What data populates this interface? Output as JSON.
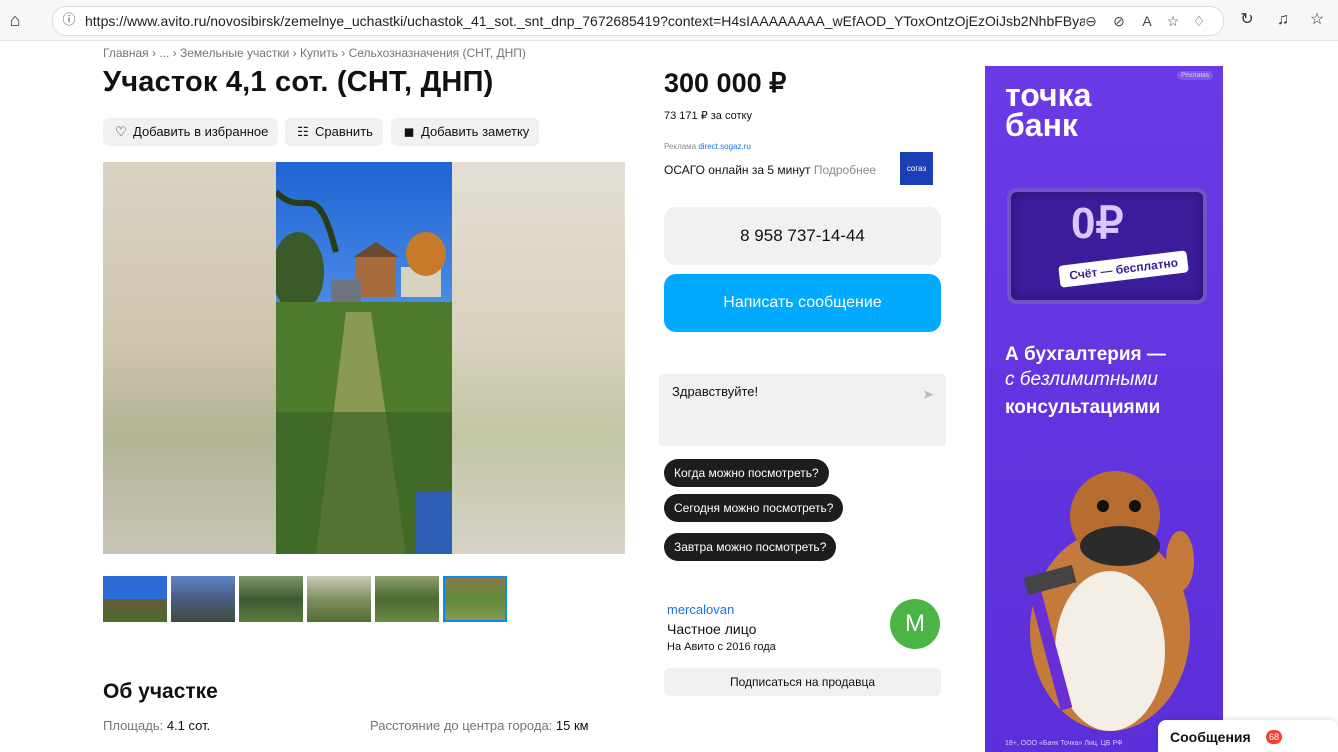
{
  "browser": {
    "url": "https://www.avito.ru/novosibirsk/zemelnye_uchastki/uchastok_41_sot._snt_dnp_7672685419?context=H4sIAAAAAAAA_wEfAOD_YToxOntzOjEzOiJsb2NhbFByaW9yaXR..."
  },
  "breadcrumbs": "Главная › ... › Земельные участки › Купить › Сельхозназначения (СНТ, ДНП)",
  "listing": {
    "title": "Участок 4,1 сот. (СНТ, ДНП)",
    "actions": {
      "favorite": "Добавить в избранное",
      "compare": "Сравнить",
      "note": "Добавить заметку"
    },
    "about_heading": "Об участке",
    "params": [
      {
        "label": "Площадь:",
        "value": "4.1 сот."
      },
      {
        "label": "Расстояние до центра города:",
        "value": "15 км"
      }
    ],
    "thumbnails_count": 6,
    "selected_thumbnail": 6
  },
  "sidebar": {
    "price": "300 000 ₽",
    "price_per": "73 171 ₽ за сотку",
    "ad_label": "Реклама",
    "ad_domain": "direct.sogaz.ru",
    "ad_text": "ОСАГО онлайн за 5 минут",
    "ad_more": "Подробнее",
    "ad_logo_text": "согаз",
    "phone": "8 958 737-14-44",
    "write_button": "Написать сообщение",
    "chat_text": "Здравствуйте!",
    "quick_questions": [
      "Когда можно посмотреть?",
      "Сегодня можно посмотреть?",
      "Завтра можно посмотреть?"
    ],
    "seller_name": "mercalovan",
    "seller_type": "Частное лицо",
    "seller_since": "На Авито с 2016 года",
    "avatar_letter": "M",
    "subscribe_button": "Подписаться на продавца"
  },
  "banner": {
    "tag": "Реклама",
    "brand_line1": "точка",
    "brand_line2": "банк",
    "zero": "0₽",
    "pill": "Счёт — бесплатно",
    "line1": "А бухгалтерия —",
    "line2": "с безлимитными",
    "line3": "консультациями",
    "legal": "18+, ООО «Банк Точка» Лиц. ЦБ РФ"
  },
  "messages_panel": {
    "label": "Сообщения",
    "count": "68"
  },
  "colors": {
    "accent": "#00aaff",
    "banner": "#5b2fd9",
    "avatar": "#4ab544",
    "badge": "#ff3b30"
  }
}
